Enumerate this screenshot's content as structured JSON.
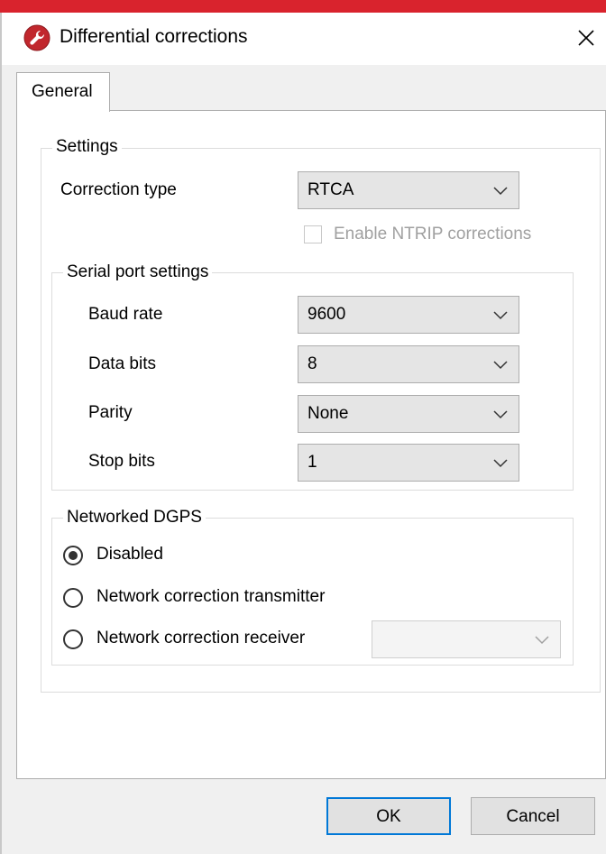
{
  "window": {
    "title": "Differential corrections"
  },
  "tabs": [
    {
      "label": "General"
    }
  ],
  "settings": {
    "group_title": "Settings",
    "correction_type": {
      "label": "Correction type",
      "value": "RTCA"
    },
    "ntrip": {
      "label": "Enable NTRIP corrections",
      "checked": false,
      "enabled": false
    }
  },
  "serial": {
    "group_title": "Serial port settings",
    "baud_rate": {
      "label": "Baud rate",
      "value": "9600"
    },
    "data_bits": {
      "label": "Data bits",
      "value": "8"
    },
    "parity": {
      "label": "Parity",
      "value": "None"
    },
    "stop_bits": {
      "label": "Stop bits",
      "value": "1"
    }
  },
  "networked": {
    "group_title": "Networked DGPS",
    "options": [
      {
        "label": "Disabled",
        "selected": true
      },
      {
        "label": "Network correction transmitter",
        "selected": false
      },
      {
        "label": "Network correction receiver",
        "selected": false
      }
    ],
    "receiver_select": {
      "value": "",
      "enabled": false
    }
  },
  "buttons": {
    "ok": "OK",
    "cancel": "Cancel"
  },
  "colors": {
    "accent_bar": "#d9232d",
    "focus_border": "#0078d7"
  }
}
